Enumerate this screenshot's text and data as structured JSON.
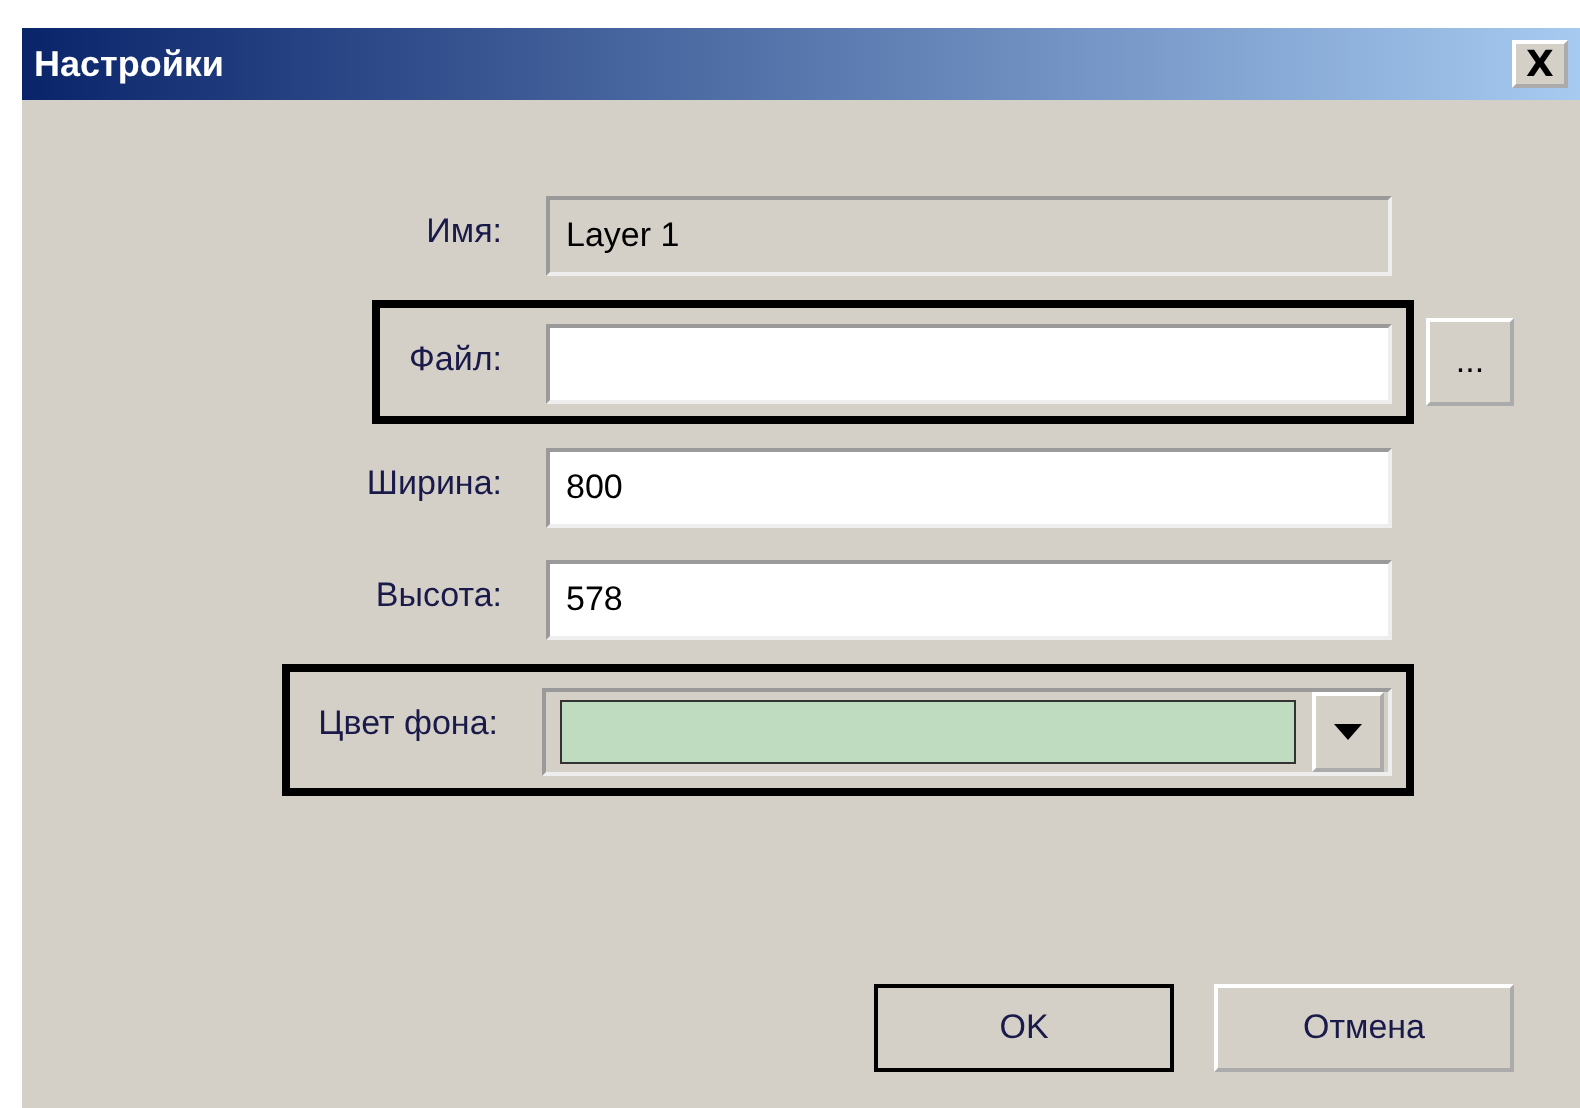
{
  "window": {
    "title": "Настройки",
    "close": "X"
  },
  "fields": [
    {
      "kind": "text",
      "label": "Имя:",
      "value": "Layer 1",
      "disabled": true,
      "highlighted": false
    },
    {
      "kind": "file",
      "label": "Файл:",
      "browse": "...",
      "disabled": false,
      "highlighted": true
    },
    {
      "kind": "text",
      "label": "Ширина:",
      "value": "800",
      "disabled": false,
      "highlighted": false
    },
    {
      "kind": "text",
      "label": "Высота:",
      "value": "578",
      "disabled": false,
      "highlighted": false
    },
    {
      "kind": "color",
      "label": "Цвет фона:",
      "color": "#c0dcc0",
      "highlighted": true
    }
  ],
  "buttons": [
    {
      "label": "OK",
      "default": true
    },
    {
      "label": "Отмена",
      "default": false
    }
  ]
}
